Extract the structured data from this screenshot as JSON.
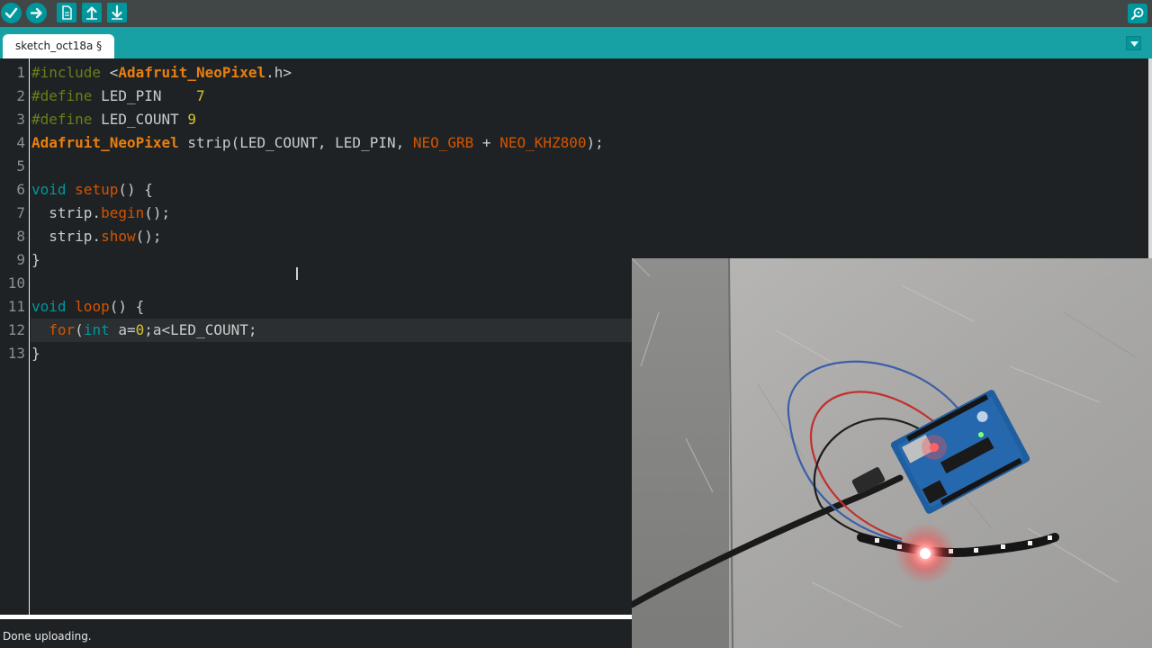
{
  "toolbar": {
    "buttons": [
      {
        "name": "verify-button",
        "icon": "checkmark-icon"
      },
      {
        "name": "upload-button",
        "icon": "arrow-right-icon"
      },
      {
        "name": "new-button",
        "icon": "new-file-icon"
      },
      {
        "name": "open-button",
        "icon": "arrow-up-icon"
      },
      {
        "name": "save-button",
        "icon": "arrow-down-icon"
      }
    ],
    "serial_monitor_icon": "serial-monitor-icon"
  },
  "tabs": [
    {
      "label": "sketch_oct18a §"
    }
  ],
  "editor": {
    "line_numbers": [
      "1",
      "2",
      "3",
      "4",
      "5",
      "6",
      "7",
      "8",
      "9",
      "10",
      "11",
      "12",
      "13"
    ],
    "lines": [
      [
        {
          "t": "#include",
          "c": "pp"
        },
        {
          "t": " <",
          "c": "plain"
        },
        {
          "t": "Adafruit_NeoPixel",
          "c": "lib"
        },
        {
          "t": ".h>",
          "c": "plain"
        }
      ],
      [
        {
          "t": "#define",
          "c": "pp"
        },
        {
          "t": " LED_PIN    ",
          "c": "plain"
        },
        {
          "t": "7",
          "c": "num"
        }
      ],
      [
        {
          "t": "#define",
          "c": "pp"
        },
        {
          "t": " LED_COUNT ",
          "c": "plain"
        },
        {
          "t": "9",
          "c": "num"
        }
      ],
      [
        {
          "t": "Adafruit_NeoPixel",
          "c": "lib"
        },
        {
          "t": " strip(LED_COUNT, LED_PIN, ",
          "c": "plain"
        },
        {
          "t": "NEO_GRB",
          "c": "fn"
        },
        {
          "t": " + ",
          "c": "plain"
        },
        {
          "t": "NEO_KHZ800",
          "c": "fn"
        },
        {
          "t": ");",
          "c": "plain"
        }
      ],
      [],
      [
        {
          "t": "void",
          "c": "kw"
        },
        {
          "t": " ",
          "c": "plain"
        },
        {
          "t": "setup",
          "c": "fn"
        },
        {
          "t": "() {",
          "c": "plain"
        }
      ],
      [
        {
          "t": "  strip.",
          "c": "plain"
        },
        {
          "t": "begin",
          "c": "fn"
        },
        {
          "t": "();",
          "c": "plain"
        }
      ],
      [
        {
          "t": "  strip.",
          "c": "plain"
        },
        {
          "t": "show",
          "c": "fn"
        },
        {
          "t": "();",
          "c": "plain"
        }
      ],
      [
        {
          "t": "}",
          "c": "plain"
        }
      ],
      [],
      [
        {
          "t": "void",
          "c": "kw"
        },
        {
          "t": " ",
          "c": "plain"
        },
        {
          "t": "loop",
          "c": "fn"
        },
        {
          "t": "() {",
          "c": "plain"
        }
      ],
      [
        {
          "t": "  ",
          "c": "plain"
        },
        {
          "t": "for",
          "c": "fn"
        },
        {
          "t": "(",
          "c": "plain"
        },
        {
          "t": "int",
          "c": "kw"
        },
        {
          "t": " a=",
          "c": "plain"
        },
        {
          "t": "0",
          "c": "num"
        },
        {
          "t": ";a<LED_COUNT;",
          "c": "plain"
        }
      ],
      [
        {
          "t": "}",
          "c": "plain"
        }
      ]
    ],
    "highlighted_line": 12
  },
  "status": {
    "message": "Done uploading."
  },
  "colors": {
    "toolbar_bg": "#414647",
    "tabbar_bg": "#17a1a5",
    "editor_bg": "#1f2224",
    "button_teal": "#00979c",
    "keyword": "#00979c",
    "function": "#d35400",
    "preprocessor": "#6a7e17",
    "number": "#d4c42e"
  },
  "overlay": {
    "type": "camera-video",
    "subject": "arduino-board-led-strip-photo"
  }
}
